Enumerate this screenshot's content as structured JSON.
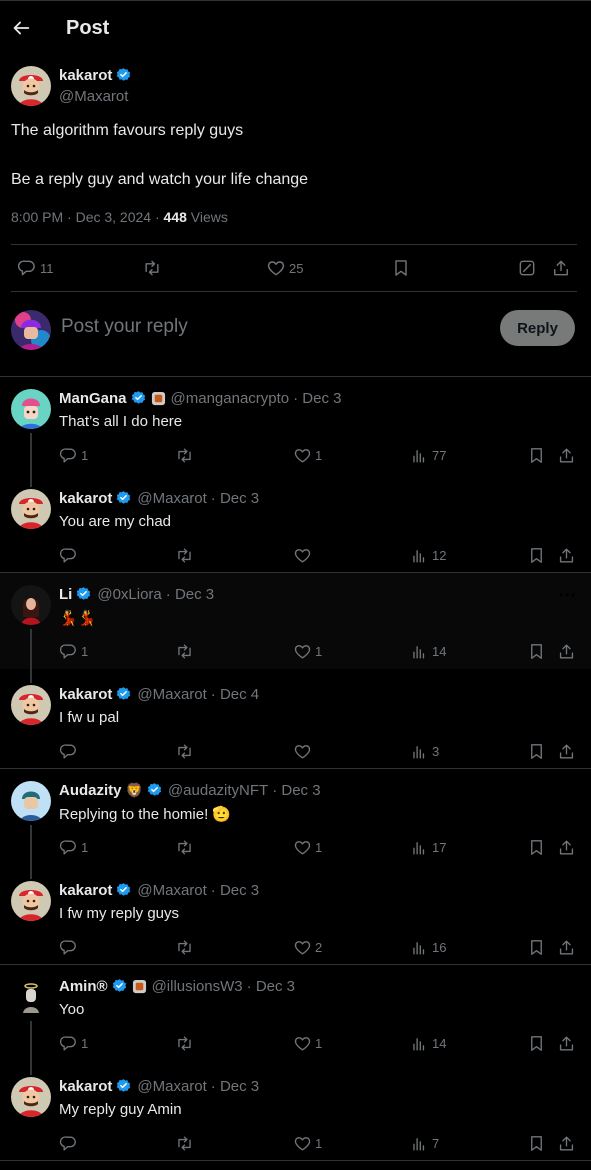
{
  "header": {
    "title": "Post"
  },
  "main_post": {
    "name": "kakarot",
    "handle": "@Maxarot",
    "line1": "The algorithm favours reply guys",
    "line2": "Be a reply guy and watch your life change",
    "time": "8:00 PM · Dec 3, 2024 · ",
    "views_count": "448",
    "views_label": " Views",
    "replies": "11",
    "likes": "25"
  },
  "composer": {
    "placeholder": "Post your reply",
    "button": "Reply"
  },
  "replies": [
    {
      "name": "ManGana",
      "handle": "@manganacrypto",
      "date": "· Dec 3",
      "text": "That’s all I do here",
      "replies": "1",
      "likes": "1",
      "views": "77"
    },
    {
      "name": "kakarot",
      "handle": "@Maxarot",
      "date": "· Dec 3",
      "text": "You are my chad",
      "replies": "",
      "likes": "",
      "views": "12"
    },
    {
      "name": "Li",
      "handle": "@0xLiora",
      "date": "· Dec 3",
      "text": "💃💃",
      "replies": "1",
      "likes": "1",
      "views": "14"
    },
    {
      "name": "kakarot",
      "handle": "@Maxarot",
      "date": "· Dec 4",
      "text": "I fw u pal",
      "replies": "",
      "likes": "",
      "views": "3"
    },
    {
      "name": "Audazity",
      "name_emoji": "🦁",
      "handle": "@audazityNFT",
      "date": "· Dec 3",
      "text": "Replying to the homie! 🫡",
      "replies": "1",
      "likes": "1",
      "views": "17"
    },
    {
      "name": "kakarot",
      "handle": "@Maxarot",
      "date": "· Dec 3",
      "text": "I fw my reply guys",
      "replies": "",
      "likes": "2",
      "views": "16"
    },
    {
      "name": "Amin®",
      "handle": "@illusionsW3",
      "date": "· Dec 3",
      "text": "Yoo",
      "replies": "1",
      "likes": "1",
      "views": "14"
    },
    {
      "name": "kakarot",
      "handle": "@Maxarot",
      "date": "· Dec 3",
      "text": "My reply guy Amin",
      "replies": "",
      "likes": "1",
      "views": "7"
    }
  ],
  "colors": {
    "background": "#000000",
    "text": "#e7e9ea",
    "muted": "#71767b",
    "border": "#2f3336",
    "verified": "#1d9bf0"
  }
}
